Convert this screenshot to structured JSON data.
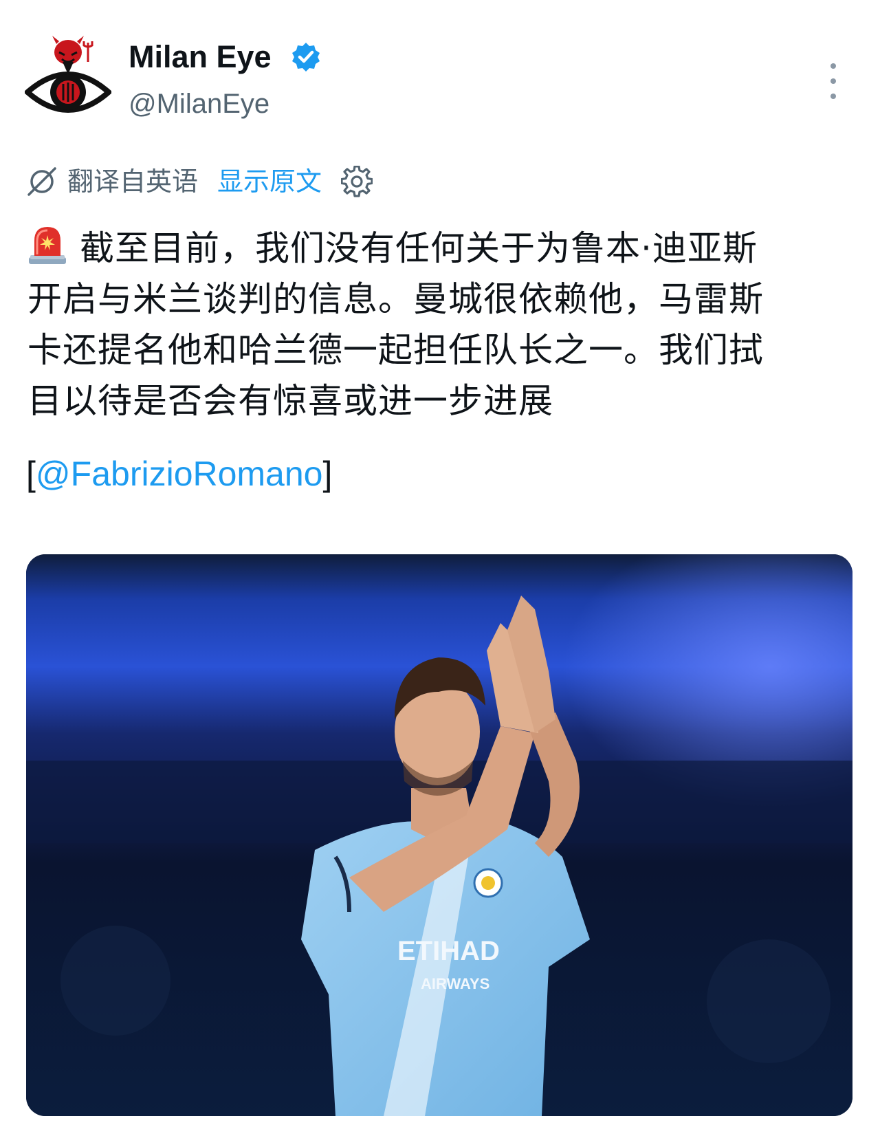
{
  "tweet": {
    "author": {
      "display_name": "Milan Eye",
      "handle": "@MilanEye",
      "verified": true,
      "avatar_icon": "devil-eye-logo-icon"
    },
    "translation_bar": {
      "label": "翻译自英语",
      "show_original": "显示原文"
    },
    "text_lines": [
      "截至目前，我们没有任何关于为鲁本·迪亚斯",
      "开启与米兰谈判的信息。曼城很依赖他，马雷斯",
      "卡还提名他和哈兰德一起担任队长之一。我们拭",
      "目以待是否会有惊喜或进一步进展"
    ],
    "source_open_bracket": "[",
    "source_mention": "@FabrizioRomano",
    "source_close_bracket": "]",
    "media": {
      "kit_sponsor_line1": "ETIHAD",
      "kit_sponsor_line2": "AIRWAYS"
    }
  },
  "colors": {
    "link": "#1d9bf0",
    "verified": "#1d9bf0",
    "secondary_text": "#536471",
    "primary_text": "#0f1419"
  },
  "icons": {
    "verified": "verified-badge-icon",
    "translate": "translate-icon",
    "settings": "gear-icon",
    "more": "more-options-icon",
    "siren": "police-siren-icon"
  }
}
